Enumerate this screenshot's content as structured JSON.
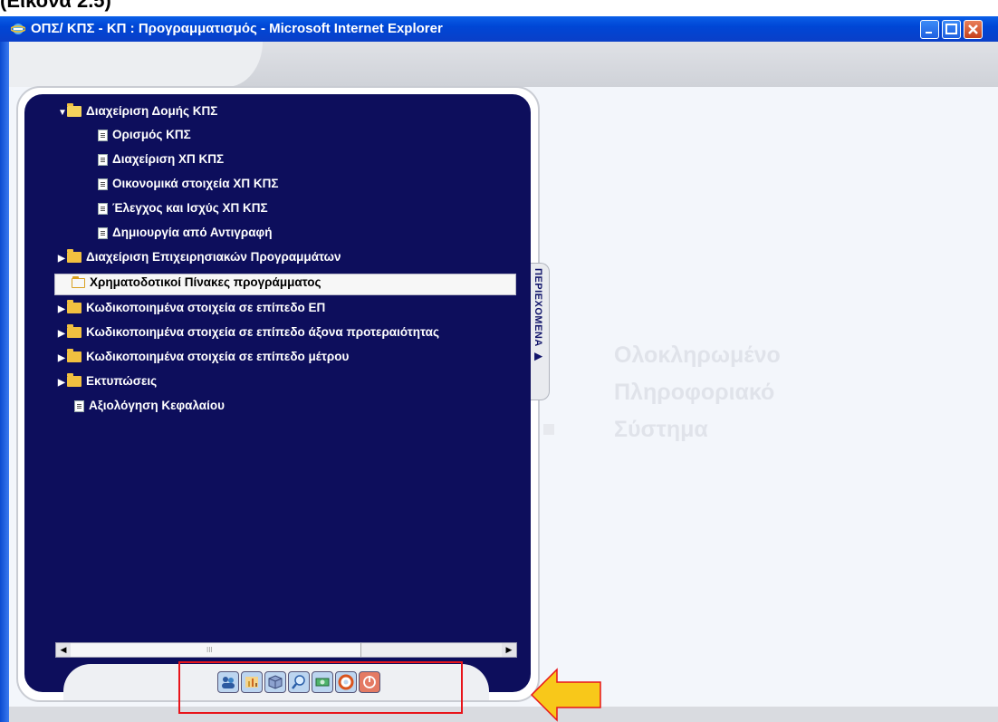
{
  "caption": "(Εικόνα 2.5)",
  "window": {
    "title": "ΟΠΣ/ ΚΠΣ - ΚΠ : Προγραμματισμός - Microsoft Internet Explorer"
  },
  "sidebar": {
    "tab_label": "ΠΕΡΙΕΧΟΜΕΝΑ ▶",
    "items": [
      {
        "label": "Διαχείριση Δομής ΚΠΣ",
        "type": "folder-open",
        "expanded": true
      },
      {
        "label": "Ορισμός ΚΠΣ",
        "type": "document"
      },
      {
        "label": "Διαχείριση ΧΠ ΚΠΣ",
        "type": "document"
      },
      {
        "label": "Οικονομικά στοιχεία ΧΠ ΚΠΣ",
        "type": "document"
      },
      {
        "label": "Έλεγχος και Ισχύς ΧΠ ΚΠΣ",
        "type": "document"
      },
      {
        "label": "Δημιουργία από Αντιγραφή",
        "type": "document"
      },
      {
        "label": "Διαχείριση Επιχειρησιακών Προγραμμάτων",
        "type": "folder"
      },
      {
        "label": "Χρηματοδοτικοί Πίνακες προγράμματος",
        "type": "folder",
        "selected": true
      },
      {
        "label": "Κωδικοποιημένα στοιχεία σε επίπεδο ΕΠ",
        "type": "folder"
      },
      {
        "label": "Κωδικοποιημένα στοιχεία σε επίπεδο άξονα προτεραιότητας",
        "type": "folder"
      },
      {
        "label": "Κωδικοποιημένα στοιχεία σε επίπεδο μέτρου",
        "type": "folder"
      },
      {
        "label": "Εκτυπώσεις",
        "type": "folder"
      },
      {
        "label": "Αξιολόγηση Κεφαλαίου",
        "type": "document"
      }
    ]
  },
  "logo": {
    "line1": "Ολοκληρωμένο",
    "line2": "Πληροφοριακό",
    "line3": "Σύστημα"
  },
  "toolbar": {
    "icons": [
      {
        "name": "users-icon",
        "color": "#3b82c6"
      },
      {
        "name": "chart-icon",
        "color": "#c98a2a"
      },
      {
        "name": "package-icon",
        "color": "#5a6ea8"
      },
      {
        "name": "search-icon",
        "color": "#3a7cc4"
      },
      {
        "name": "money-icon",
        "color": "#2f9a52"
      },
      {
        "name": "help-icon",
        "color": "#d9541e"
      },
      {
        "name": "power-icon",
        "color": "#d6432b"
      }
    ]
  },
  "colors": {
    "panel": "#0d0e5c",
    "titlebar": "#0046d5",
    "highlight_box": "#e8141a",
    "arrow": "#f8c81a"
  }
}
